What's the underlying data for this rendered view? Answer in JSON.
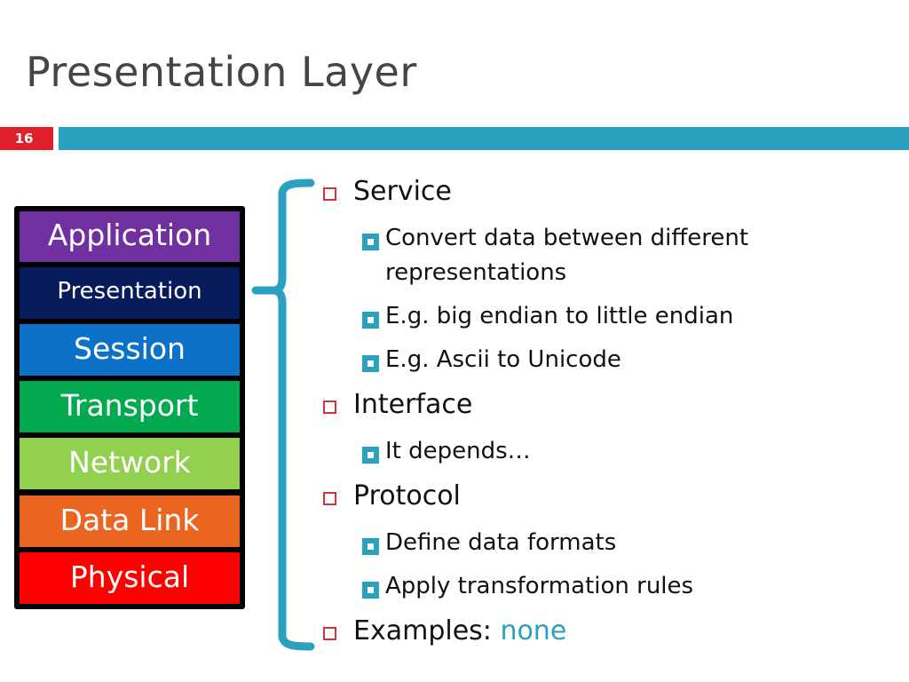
{
  "slide": {
    "title": "Presentation Layer",
    "number": "16"
  },
  "colors": {
    "accent": "#2aa1bd",
    "slide_number_bg": "#e2202b",
    "bullet_l1": "#d8323a"
  },
  "osi_stack": [
    {
      "label": "Application",
      "color": "#7030a0"
    },
    {
      "label": "Presentation",
      "color": "#071c5c"
    },
    {
      "label": "Session",
      "color": "#0c72c9"
    },
    {
      "label": "Transport",
      "color": "#02a94f"
    },
    {
      "label": "Network",
      "color": "#92d050"
    },
    {
      "label": "Data Link",
      "color": "#ea6520"
    },
    {
      "label": "Physical",
      "color": "#ff0000"
    }
  ],
  "bullets": [
    {
      "label": "Service",
      "sub": [
        {
          "line1": "Convert data between different",
          "line2": "representations"
        },
        {
          "line1": "E.g. big endian to little endian"
        },
        {
          "line1": "E.g. Ascii to Unicode"
        }
      ]
    },
    {
      "label": "Interface",
      "sub": [
        {
          "line1": "It depends…"
        }
      ]
    },
    {
      "label": "Protocol",
      "sub": [
        {
          "line1": "Define data formats"
        },
        {
          "line1": "Apply transformation rules"
        }
      ]
    },
    {
      "label": "Examples:",
      "highlight": "none",
      "sub": []
    }
  ]
}
